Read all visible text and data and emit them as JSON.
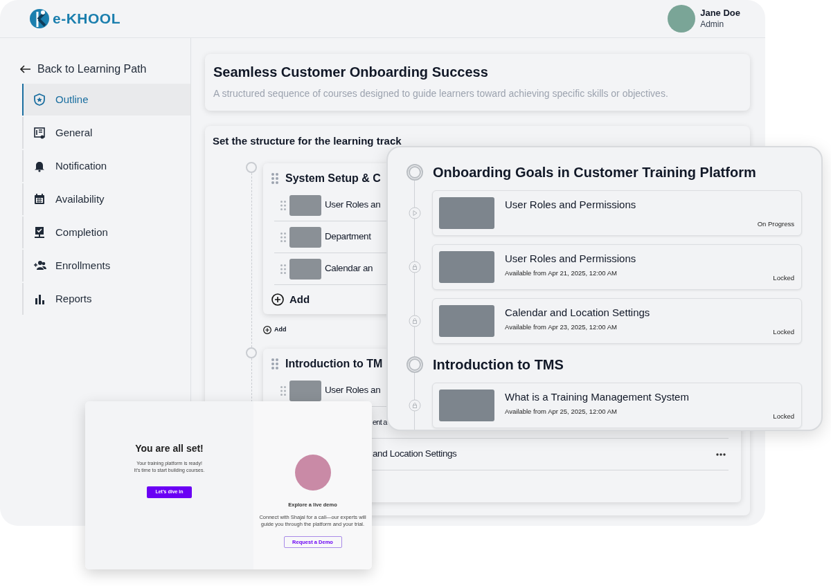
{
  "logo": {
    "text": "e-KHOOL"
  },
  "user": {
    "name": "Jane Doe",
    "role": "Admin"
  },
  "sidebar": {
    "back": "Back to Learning Path",
    "items": [
      {
        "label": "Outline",
        "selected": true
      },
      {
        "label": "General",
        "selected": false
      },
      {
        "label": "Notification",
        "selected": false
      },
      {
        "label": "Availability",
        "selected": false
      },
      {
        "label": "Completion",
        "selected": false
      },
      {
        "label": "Enrollments",
        "selected": false
      },
      {
        "label": "Reports",
        "selected": false
      }
    ]
  },
  "header_card": {
    "title": "Seamless Customer Onboarding Success",
    "description": "A structured sequence of courses designed to guide learners toward achieving specific skills or objectives."
  },
  "structure": {
    "title": "Set the structure for the learning track",
    "sections": [
      {
        "title": "System Setup & C",
        "add_label": "Add",
        "add_section_label": "Add",
        "rows": [
          {
            "kind": "full",
            "title": "User Roles an"
          },
          {
            "kind": "full",
            "title": "Department"
          },
          {
            "kind": "full",
            "title": "Calendar an"
          }
        ]
      },
      {
        "title": "Introduction to TM",
        "rows": [
          {
            "kind": "full",
            "title": "User Roles an"
          },
          {
            "kind": "tail",
            "title": "ent a"
          },
          {
            "kind": "tail_menu",
            "title": "and Location Settings"
          }
        ]
      }
    ]
  },
  "goals_panel": {
    "sections": [
      {
        "title": "Onboarding Goals in Customer Training Platform",
        "items": [
          {
            "kind": "progress",
            "title": "User Roles and Permissions",
            "status": "On Progress"
          },
          {
            "kind": "locked",
            "title": "User Roles and Permissions",
            "available": "Available from Apr 21, 2025, 12:00 AM",
            "status": "Locked"
          },
          {
            "kind": "locked",
            "title": "Calendar and Location Settings",
            "available": "Available from Apr 23, 2025, 12:00 AM",
            "status": "Locked"
          }
        ]
      },
      {
        "title": "Introduction to TMS",
        "items": [
          {
            "kind": "locked",
            "title": "What is a Training Management System",
            "available": "Available from Apr 25, 2025, 12:00 AM",
            "status": "Locked"
          }
        ]
      }
    ]
  },
  "welcome": {
    "title": "You are all set!",
    "lines": [
      "Your training platform is ready!",
      "It’s time to start building courses."
    ],
    "button": "Let’s dive in",
    "demo_title": "Explore a live demo",
    "demo_text": "Connect with Shajal for a call—our experts will guide you through the platform and your trial.",
    "demo_button": "Request a Demo"
  }
}
